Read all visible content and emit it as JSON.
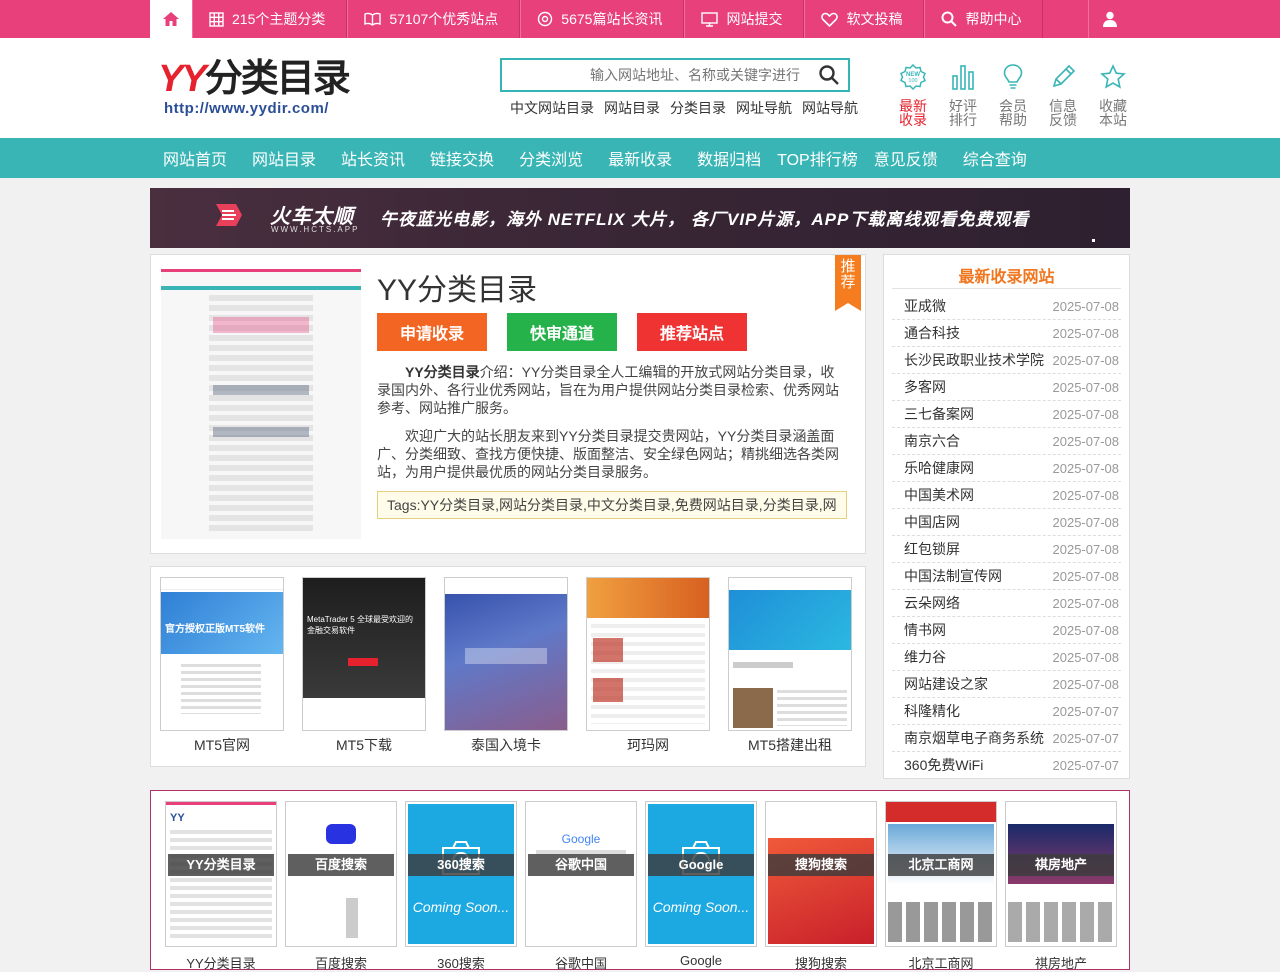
{
  "topbar": {
    "items": [
      {
        "icon": "grid-icon",
        "label": "215个主题分类"
      },
      {
        "icon": "book-icon",
        "label": "57107个优秀站点"
      },
      {
        "icon": "target-icon",
        "label": "5675篇站长资讯"
      },
      {
        "icon": "monitor-icon",
        "label": "网站提交"
      },
      {
        "icon": "heart-icon",
        "label": "软文投稿"
      },
      {
        "icon": "search-icon",
        "label": "帮助中心"
      }
    ]
  },
  "logo": {
    "yy": "YY",
    "cn": "分类目录",
    "url": "http://www.yydir.com/"
  },
  "search": {
    "placeholder": "输入网站地址、名称或关键字进行"
  },
  "hotlinks": [
    "中文网站目录",
    "网站目录",
    "分类目录",
    "网址导航",
    "网站导航"
  ],
  "header_icons": [
    {
      "label": "最新收录",
      "icon": "new-badge-icon",
      "accent": true
    },
    {
      "label": "好评排行",
      "icon": "bar-chart-icon"
    },
    {
      "label": "会员帮助",
      "icon": "lightbulb-icon"
    },
    {
      "label": "信息反馈",
      "icon": "pencil-icon"
    },
    {
      "label": "收藏本站",
      "icon": "star-icon"
    }
  ],
  "nav": [
    "网站首页",
    "网站目录",
    "站长资讯",
    "链接交换",
    "分类浏览",
    "最新收录",
    "数据归档",
    "TOP排行榜",
    "意见反馈",
    "综合查询"
  ],
  "banner": {
    "brand": "火车太顺",
    "site": "WWW.HCTS.APP",
    "slogan": "午夜蓝光电影，海外 NETFLIX 大片，   各厂VIP片源，APP下载离线观看免费观看"
  },
  "site": {
    "title": "YY分类目录",
    "ribbon": "推荐",
    "buttons": [
      "申请收录",
      "快审通道",
      "推荐站点"
    ],
    "desc_name": "YY分类目录",
    "desc1": "介绍：YY分类目录全人工编辑的开放式网站分类目录，收录国内外、各行业优秀网站，旨在为用户提供网站分类目录检索、优秀网站参考、网站推广服务。",
    "desc2": "欢迎广大的站长朋友来到YY分类目录提交贵网站，YY分类目录涵盖面广、分类细致、查找方便快捷、版面整洁、安全绿色网站；精挑细选各类网站，为用户提供最优质的网站分类目录服务。",
    "tags": "Tags:YY分类目录,网站分类目录,中文分类目录,免费网站目录,分类目录,网"
  },
  "related": [
    "MT5官网",
    "MT5下载",
    "泰国入境卡",
    "珂玛网",
    "MT5搭建出租"
  ],
  "sidebar": {
    "title": "最新收录网站",
    "items": [
      {
        "name": "亚成微",
        "date": "2025-07-08"
      },
      {
        "name": "通合科技",
        "date": "2025-07-08"
      },
      {
        "name": "长沙民政职业技术学院",
        "date": "2025-07-08"
      },
      {
        "name": "多客网",
        "date": "2025-07-08"
      },
      {
        "name": "三七备案网",
        "date": "2025-07-08"
      },
      {
        "name": "南京六合",
        "date": "2025-07-08"
      },
      {
        "name": "乐哈健康网",
        "date": "2025-07-08"
      },
      {
        "name": "中国美术网",
        "date": "2025-07-08"
      },
      {
        "name": "中国店网",
        "date": "2025-07-08"
      },
      {
        "name": "红包锁屏",
        "date": "2025-07-08"
      },
      {
        "name": "中国法制宣传网",
        "date": "2025-07-08"
      },
      {
        "name": "云朵网络",
        "date": "2025-07-08"
      },
      {
        "name": "情书网",
        "date": "2025-07-08"
      },
      {
        "name": "维力谷",
        "date": "2025-07-08"
      },
      {
        "name": "网站建设之家",
        "date": "2025-07-08"
      },
      {
        "name": "科隆精化",
        "date": "2025-07-07"
      },
      {
        "name": "南京烟草电子商务系统",
        "date": "2025-07-07"
      },
      {
        "name": "360免费WiFi",
        "date": "2025-07-07"
      }
    ]
  },
  "featured": [
    {
      "overlay": "YY分类目录",
      "name": "YY分类目录"
    },
    {
      "overlay": "百度搜索",
      "name": "百度搜索"
    },
    {
      "overlay": "360搜索",
      "name": "360搜索",
      "soon": "Coming Soon..."
    },
    {
      "overlay": "谷歌中国",
      "name": "谷歌中国"
    },
    {
      "overlay": "Google",
      "name": "Google",
      "soon": "Coming Soon..."
    },
    {
      "overlay": "搜狗搜索",
      "name": "搜狗搜索"
    },
    {
      "overlay": "北京工商网",
      "name": "北京工商网"
    },
    {
      "overlay": "祺房地产",
      "name": "祺房地产"
    }
  ],
  "colors": {
    "pink": "#e8407a",
    "teal": "#39b5b6",
    "orange": "#f36523",
    "green": "#25b24a",
    "red": "#ef3333"
  }
}
